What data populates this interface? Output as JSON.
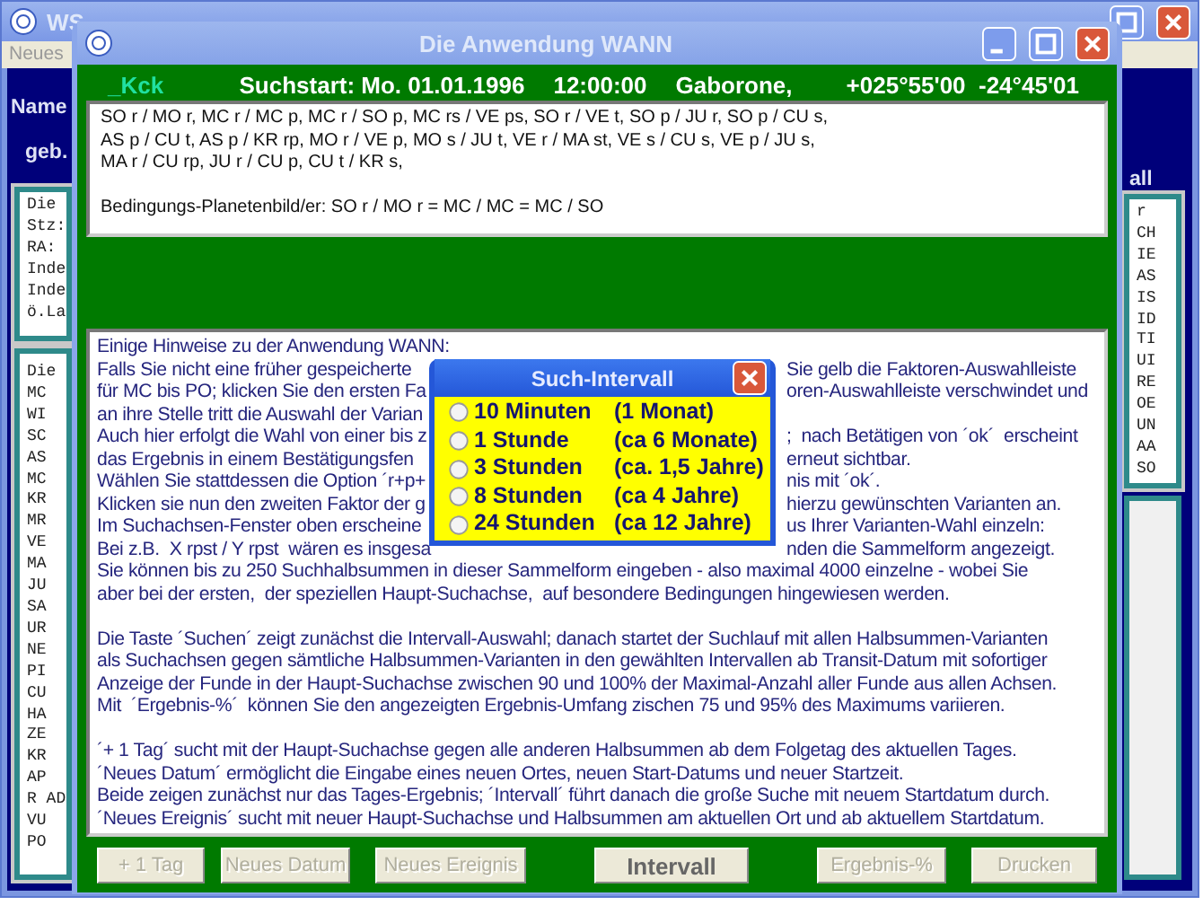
{
  "background_window": {
    "title": "WS",
    "menu_item": "Neues",
    "name_label": "Name",
    "birth_label": "geb.",
    "right_label": "all",
    "left_upper_list": [
      "Die",
      "Stz:",
      "RA:",
      "Inde",
      "Inde",
      "ö.La"
    ],
    "left_lower_list": [
      "Die",
      "MC",
      "WI",
      "SC",
      "AS",
      "MC",
      "KR",
      "MR",
      "VE",
      "MA",
      "JU",
      "SA",
      "UR",
      "NE",
      "PI",
      "CU",
      "HA",
      "ZE",
      "KR",
      "AP",
      "R AD",
      "VU",
      "PO"
    ],
    "right_upper_list": [
      "r",
      "CH",
      "IE",
      "AS",
      "IS",
      "ID",
      "TI",
      "UI",
      "RE",
      "OE",
      "UN",
      "AA",
      "SO"
    ]
  },
  "window": {
    "title": "Die Anwendung WANN"
  },
  "header": {
    "code": "_Kck",
    "search_start": "Suchstart: Mo. 01.01.1996",
    "time": "12:00:00",
    "place": "Gaborone,",
    "coordinates": "+025°55'00  -24°45'01"
  },
  "factors": {
    "lines": [
      "SO r / MO r, MC r / MC p, MC r / SO p, MC rs / VE ps, SO r / VE t, SO p / JU r, SO p / CU s,",
      "AS p / CU t, AS p / KR rp, MO r / VE p, MO s / JU t, VE r / MA st, VE s / CU s, VE p / JU s,",
      "MA r / CU rp, JU r / CU p, CU t / KR s,"
    ],
    "condition": "Bedingungs-Planetenbild/er: SO r / MO r = MC / MC = MC / SO"
  },
  "hint_paragraphs": [
    [
      {
        "left": "Einige Hinweise zu der Anwendung WANN:"
      },
      {
        "left": "Falls Sie nicht eine früher gespeicherte",
        "right": "Sie gelb die Faktoren-Auswahlleiste"
      },
      {
        "left": "für MC bis PO; klicken Sie den ersten Fa",
        "right": "oren-Auswahlleiste verschwindet und"
      },
      {
        "left": "an ihre Stelle tritt die Auswahl der Varian"
      },
      {
        "left": "Auch hier erfolgt die Wahl von einer bis z",
        "right": ";  nach Betätigen von ´ok´  erscheint"
      },
      {
        "left": "das Ergebnis in einem Bestätigungsfen",
        "right": "erneut sichtbar."
      },
      {
        "left": "Wählen Sie stattdessen die Option ´r+p+",
        "right": "nis mit ´ok´."
      },
      {
        "left": "Klicken sie nun den zweiten Faktor der g",
        "right": "hierzu gewünschten Varianten an."
      },
      {
        "left": "Im Suchachsen-Fenster oben erscheine",
        "right": "us Ihrer Varianten-Wahl einzeln:"
      },
      {
        "left": "Bei z.B.  X rpst / Y rpst  wären es insgesa",
        "right": "nden die Sammelform angezeigt."
      },
      {
        "left": "Sie können bis zu 250 Suchhalbsummen in dieser Sammelform eingeben - also maximal 4000 einzelne - wobei Sie"
      },
      {
        "left": "aber bei der ersten,  der speziellen Haupt-Suchachse,  auf besondere Bedingungen hingewiesen werden."
      }
    ],
    [
      {
        "left": "Die Taste ´Suchen´ zeigt zunächst die Intervall-Auswahl; danach startet der Suchlauf mit allen Halbsummen-Varianten"
      },
      {
        "left": "als Suchachsen gegen sämtliche Halbsummen-Varianten in den gewählten Intervallen ab Transit-Datum mit sofortiger"
      },
      {
        "left": "Anzeige der Funde in der Haupt-Suchachse zwischen 90 und 100% der Maximal-Anzahl aller Funde aus allen Achsen."
      },
      {
        "left": "Mit  ´Ergebnis-%´  können Sie den angezeigten Ergebnis-Umfang zischen 75 und 95% des Maximums variieren."
      }
    ],
    [
      {
        "left": "´+ 1 Tag´ sucht mit der Haupt-Suchachse gegen alle anderen Halbsummen ab dem Folgetag des aktuellen Tages."
      },
      {
        "left": "´Neues Datum´ ermöglicht die Eingabe eines neuen Ortes, neuen Start-Datums und neuer Startzeit."
      },
      {
        "left": "Beide zeigen zunächst nur das Tages-Ergebnis; ´Intervall´ führt danach die große Suche mit neuem Startdatum durch."
      },
      {
        "left": "´Neues Ereignis´ sucht mit neuer Haupt-Suchachse und Halbsummen am aktuellen Ort und ab aktuellem Startdatum."
      }
    ]
  ],
  "buttons": [
    {
      "label": "+ 1 Tag",
      "disabled": true
    },
    {
      "label": "Neues Datum",
      "disabled": true
    },
    {
      "label": "Neues Ereignis",
      "disabled": true
    },
    {
      "label": "Intervall",
      "disabled": false
    },
    {
      "label": "Ergebnis-%",
      "disabled": true
    },
    {
      "label": "Drucken",
      "disabled": true
    }
  ],
  "dialog": {
    "title": "Such-Intervall",
    "options": [
      {
        "label": "10 Minuten",
        "period": "(1 Monat)",
        "selected": false
      },
      {
        "label": "1 Stunde",
        "period": "(ca 6 Monate)",
        "selected": false
      },
      {
        "label": "3 Stunden",
        "period": "(ca. 1,5 Jahre)",
        "selected": false
      },
      {
        "label": "8 Stunden",
        "period": "(ca 4 Jahre)",
        "selected": false
      },
      {
        "label": "24 Stunden",
        "period": "(ca 12 Jahre)",
        "selected": false
      }
    ]
  }
}
